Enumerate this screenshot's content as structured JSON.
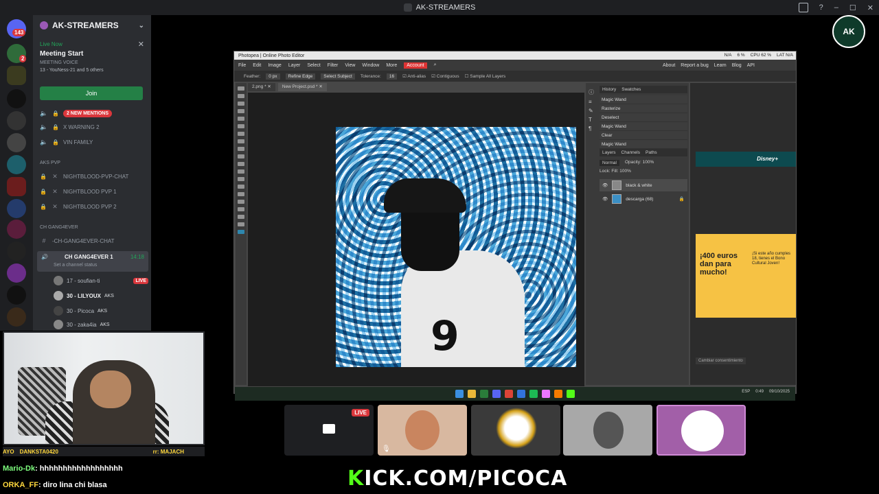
{
  "app": {
    "title": "AK-STREAMERS"
  },
  "rail": {
    "notif_count": "143",
    "dm_badge": "2"
  },
  "server": {
    "name": "AK-STREAMERS"
  },
  "live_event": {
    "status": "Live Now",
    "title": "Meeting Start",
    "channel": "MEETING VOICE",
    "attendees": "13 - YouNess-21 and 5 others",
    "join_label": "Join"
  },
  "channels": [
    {
      "label": "2 NEW MENTIONS",
      "type": "mention"
    },
    {
      "label": "X WARNING 2"
    },
    {
      "label": "VIN FAMILY"
    }
  ],
  "category_aks": "AKS PVP",
  "aks_channels": [
    "NIGHTBLOOD-PVP-CHAT",
    "NIGHTBLOOD PVP 1",
    "NIGHTBLOOD PVP 2"
  ],
  "category_gang": "CH GANG4EVER",
  "gang_chat": "-CH-GANG4EVER-CHAT",
  "active_voice": {
    "name": "CH GANG4EVER 1",
    "time": "14:18",
    "status": "Set a channel status"
  },
  "members": [
    {
      "name": "17 - soufian-ti",
      "live": "LIVE"
    },
    {
      "name": "30 - LILYOUX",
      "tag": "AKS"
    },
    {
      "name": "30 - Picoca",
      "tag": "AKS"
    },
    {
      "name": "30 - zaka4ia",
      "tag": "AKS"
    }
  ],
  "cam_overlay": {
    "left": "AYO",
    "user": "DANKSTA0420",
    "right": "rr: MAJACH"
  },
  "chat": [
    {
      "user": "Mario-Dk",
      "text": ": hhhhhhhhhhhhhhhhhh"
    },
    {
      "user": "ORKA_FF",
      "text": ": diro lina chi blasa"
    }
  ],
  "photopea": {
    "title": "Photopea | Online Photo Editor",
    "menu": [
      "File",
      "Edit",
      "Image",
      "Layer",
      "Select",
      "Filter",
      "View",
      "Window",
      "More"
    ],
    "account": "Account",
    "links": [
      "About",
      "Report a bug",
      "Learn",
      "Blog",
      "API"
    ],
    "options": {
      "feather": "Feather:",
      "feather_val": "0 px",
      "refine": "Refine Edge",
      "select_subject": "Select Subject",
      "tolerance": "Tolerance:",
      "tolerance_val": "16",
      "antialias": "Anti-alias",
      "contiguous": "Contiguous",
      "sample_all": "Sample All Layers"
    },
    "tabs": [
      "2.png *",
      "New Project.psd *"
    ],
    "jersey_number": "9",
    "history_tabs": [
      "History",
      "Swatches"
    ],
    "history": [
      "Magic Wand",
      "Rasterize",
      "Deselect",
      "Magic Wand",
      "Clear",
      "Magic Wand"
    ],
    "layer_tabs": [
      "Layers",
      "Channels",
      "Paths"
    ],
    "blend": "Normal",
    "opacity": "Opacity: 100%",
    "lock_fill": "Lock:      Fill: 100%",
    "layers": [
      "black & white",
      "descarga (68)"
    ],
    "stats": [
      "N/A",
      "6 %",
      "CPU 62 %",
      "LAT N/A"
    ],
    "ad_disney": "Disney+",
    "ad_big": "¡400 euros dan para mucho!",
    "ad_small": "¡Si este año cumples 18, tienes el Bono Cultural Joven!",
    "cookie": "Cambiar consentimiento",
    "clock": "0:49",
    "date": "09/10/2025",
    "lang": "ESP"
  },
  "tiles": [
    {
      "live": "LIVE"
    }
  ],
  "kick": {
    "brand": "K",
    "rest": "ICK.COM/PICOCA"
  },
  "top_logo": "AK"
}
